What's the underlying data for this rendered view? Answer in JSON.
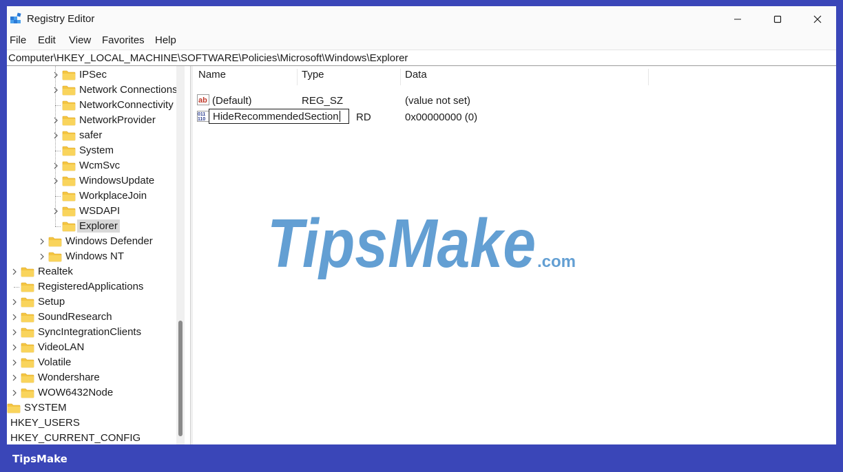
{
  "window": {
    "title": "Registry Editor"
  },
  "menu": [
    "File",
    "Edit",
    "View",
    "Favorites",
    "Help"
  ],
  "address": "Computer\\HKEY_LOCAL_MACHINE\\SOFTWARE\\Policies\\Microsoft\\Windows\\Explorer",
  "tree": [
    {
      "label": "IPSec",
      "expandable": true
    },
    {
      "label": "Network Connections",
      "expandable": true
    },
    {
      "label": "NetworkConnectivity",
      "expandable": false
    },
    {
      "label": "NetworkProvider",
      "expandable": true
    },
    {
      "label": "safer",
      "expandable": true
    },
    {
      "label": "System",
      "expandable": false
    },
    {
      "label": "WcmSvc",
      "expandable": true
    },
    {
      "label": "WindowsUpdate",
      "expandable": true
    },
    {
      "label": "WorkplaceJoin",
      "expandable": false
    },
    {
      "label": "WSDAPI",
      "expandable": true
    },
    {
      "label": "Explorer",
      "expandable": false,
      "selected": true
    },
    {
      "label": "Windows Defender",
      "expandable": true
    },
    {
      "label": "Windows NT",
      "expandable": true
    },
    {
      "label": "Realtek",
      "expandable": true
    },
    {
      "label": "RegisteredApplications",
      "expandable": false
    },
    {
      "label": "Setup",
      "expandable": true
    },
    {
      "label": "SoundResearch",
      "expandable": true
    },
    {
      "label": "SyncIntegrationClients",
      "expandable": true
    },
    {
      "label": "VideoLAN",
      "expandable": true
    },
    {
      "label": "Volatile",
      "expandable": true
    },
    {
      "label": "Wondershare",
      "expandable": true
    },
    {
      "label": "WOW6432Node",
      "expandable": true
    },
    {
      "label": "SYSTEM",
      "expandable": false
    },
    {
      "label": "HKEY_USERS",
      "expandable": false
    },
    {
      "label": "HKEY_CURRENT_CONFIG",
      "expandable": false
    }
  ],
  "columns": {
    "name": "Name",
    "type": "Type",
    "data": "Data"
  },
  "values": [
    {
      "name": "(Default)",
      "type": "REG_SZ",
      "data": "(value not set)",
      "icon": "string-value-icon"
    },
    {
      "name": "HideRecommendedSection",
      "type": "RD",
      "data": "0x00000000 (0)",
      "icon": "binary-value-icon"
    }
  ],
  "rename_value": "HideRecommendedSection",
  "watermark": {
    "main": "TipsMake",
    "suffix": ".com"
  },
  "footer": "TipsMake",
  "colors": {
    "frame": "#3a46b8",
    "folder": "#f4c542",
    "watermark": "#2f7fc4"
  }
}
